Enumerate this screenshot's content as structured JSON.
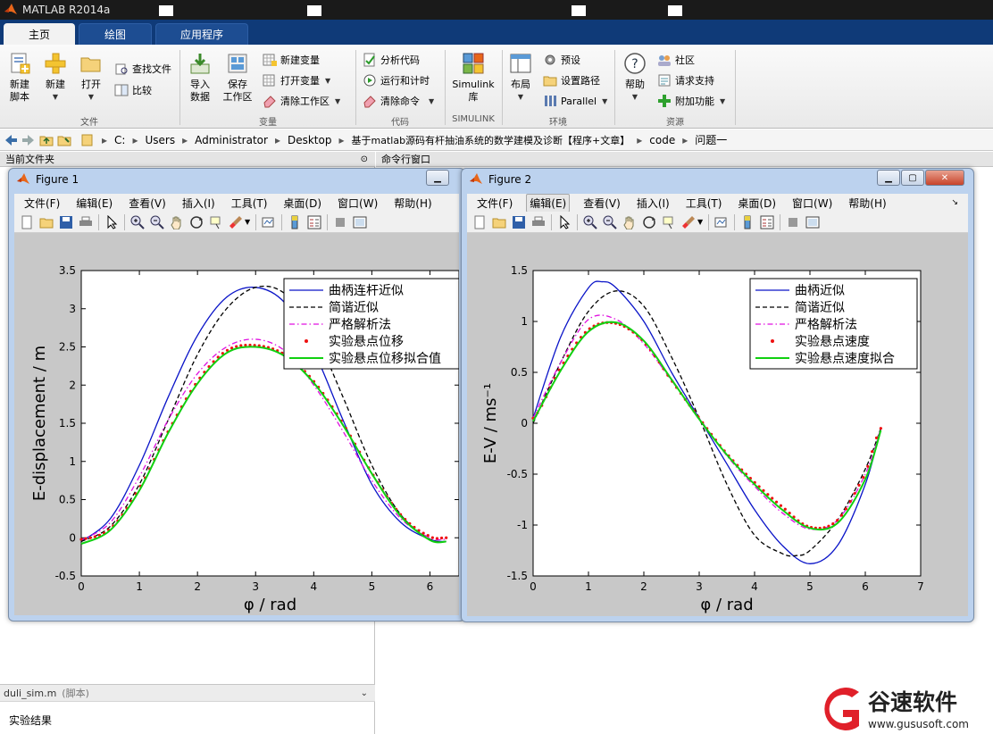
{
  "window": {
    "title": "MATLAB R2014a"
  },
  "tabs": [
    {
      "label": "主页",
      "active": true
    },
    {
      "label": "绘图",
      "active": false
    },
    {
      "label": "应用程序",
      "active": false
    }
  ],
  "ribbon": {
    "file": {
      "new_script": "新建\n脚本",
      "new": "新建",
      "open": "打开",
      "find_files": "查找文件",
      "compare": "比较",
      "group": "文件"
    },
    "variable": {
      "import_data": "导入\n数据",
      "save_workspace": "保存\n工作区",
      "new_variable": "新建变量",
      "open_variable": "打开变量",
      "clear_workspace": "清除工作区",
      "group": "变量"
    },
    "code": {
      "analyze_code": "分析代码",
      "run_and_time": "运行和计时",
      "clear_commands": "清除命令",
      "group": "代码"
    },
    "simulink": {
      "library": "Simulink\n库",
      "group": "SIMULINK"
    },
    "environment": {
      "layout": "布局",
      "preferences": "预设",
      "set_path": "设置路径",
      "parallel": "Parallel",
      "group": "环境"
    },
    "resources": {
      "help": "帮助",
      "community": "社区",
      "request_support": "请求支持",
      "addons": "附加功能",
      "group": "资源"
    }
  },
  "address": {
    "crumbs": [
      "C:",
      "Users",
      "Administrator",
      "Desktop",
      "基于matlab源码有杆抽油系统的数学建模及诊断【程序+文章】",
      "code",
      "问题一"
    ]
  },
  "panels": {
    "current_folder": "当前文件夹",
    "command_window": "命令行窗口",
    "detail_file": "duli_sim.m",
    "detail_type": "(脚本)",
    "detail_text": "实验结果"
  },
  "figure_menu": [
    "文件(F)",
    "编辑(E)",
    "查看(V)",
    "插入(I)",
    "工具(T)",
    "桌面(D)",
    "窗口(W)",
    "帮助(H)"
  ],
  "figure1": {
    "title": "Figure 1"
  },
  "figure2": {
    "title": "Figure 2"
  },
  "watermark": {
    "brand": "谷速软件",
    "url": "www.gususoft.com"
  },
  "colors": {
    "ribbon_tab_bg": "#0f3a78",
    "crank": "#0a14c8",
    "harmonic": "#000000",
    "strict": "#e010e0",
    "measured": "#ee1010",
    "fit": "#10d010"
  },
  "chart_data": [
    {
      "type": "line",
      "title": "",
      "xlabel": "φ / rad",
      "ylabel": "E-displacement / m",
      "xlim": [
        0,
        6.5
      ],
      "ylim": [
        -0.5,
        3.5
      ],
      "xticks": [
        0,
        1,
        2,
        3,
        4,
        5,
        6
      ],
      "yticks": [
        -0.5,
        0,
        0.5,
        1,
        1.5,
        2,
        2.5,
        3,
        3.5
      ],
      "grid": false,
      "legend_position": "top-right",
      "series": [
        {
          "name": "曲柄连杆近似",
          "style": "solid",
          "color": "#0a14c8",
          "x": [
            0,
            0.5,
            1,
            1.5,
            2,
            2.5,
            3,
            3.5,
            4,
            4.5,
            5,
            5.5,
            6,
            6.28
          ],
          "y": [
            -0.05,
            0.25,
            0.95,
            1.85,
            2.65,
            3.15,
            3.28,
            3.08,
            2.45,
            1.55,
            0.7,
            0.2,
            -0.02,
            -0.05
          ]
        },
        {
          "name": "简谐近似",
          "style": "dashed",
          "color": "#000000",
          "x": [
            0,
            0.5,
            1,
            1.5,
            2,
            2.5,
            3,
            3.5,
            4,
            4.5,
            5,
            5.5,
            6,
            6.28
          ],
          "y": [
            -0.05,
            0.15,
            0.7,
            1.55,
            2.4,
            3.0,
            3.28,
            3.2,
            2.7,
            1.85,
            0.95,
            0.3,
            -0.02,
            -0.05
          ]
        },
        {
          "name": "严格解析法",
          "style": "dashdot",
          "color": "#e010e0",
          "x": [
            0,
            0.5,
            1,
            1.5,
            2,
            2.5,
            3,
            3.5,
            4,
            4.5,
            5,
            5.5,
            6,
            6.28
          ],
          "y": [
            -0.03,
            0.2,
            0.8,
            1.55,
            2.15,
            2.5,
            2.6,
            2.45,
            2.0,
            1.4,
            0.75,
            0.25,
            0.0,
            -0.02
          ]
        },
        {
          "name": "实验悬点位移",
          "style": "markers",
          "color": "#ee1010",
          "x": [
            0,
            0.5,
            1,
            1.5,
            2,
            2.5,
            3,
            3.5,
            4,
            4.5,
            5,
            5.5,
            6,
            6.28
          ],
          "y": [
            -0.02,
            0.12,
            0.65,
            1.4,
            2.05,
            2.45,
            2.52,
            2.4,
            2.05,
            1.5,
            0.85,
            0.3,
            0.02,
            0.0
          ]
        },
        {
          "name": "实验悬点位移拟合值",
          "style": "solid",
          "color": "#10d010",
          "x": [
            0,
            0.5,
            1,
            1.5,
            2,
            2.5,
            3,
            3.5,
            4,
            4.5,
            5,
            5.5,
            6,
            6.28
          ],
          "y": [
            -0.08,
            0.1,
            0.62,
            1.38,
            2.02,
            2.42,
            2.5,
            2.38,
            2.03,
            1.48,
            0.84,
            0.28,
            -0.03,
            -0.05
          ]
        }
      ]
    },
    {
      "type": "line",
      "title": "",
      "xlabel": "φ / rad",
      "ylabel": "E-V / ms⁻¹",
      "xlim": [
        0,
        7
      ],
      "ylim": [
        -1.5,
        1.5
      ],
      "xticks": [
        0,
        1,
        2,
        3,
        4,
        5,
        6,
        7
      ],
      "yticks": [
        -1.5,
        -1,
        -0.5,
        0,
        0.5,
        1,
        1.5
      ],
      "grid": false,
      "legend_position": "top-right",
      "series": [
        {
          "name": "曲柄近似",
          "style": "solid",
          "color": "#0a14c8",
          "x": [
            0,
            0.5,
            1,
            1.25,
            1.5,
            2,
            2.5,
            3,
            3.5,
            4,
            4.5,
            5,
            5.5,
            6,
            6.28
          ],
          "y": [
            0.05,
            0.85,
            1.33,
            1.39,
            1.33,
            1.0,
            0.5,
            0.05,
            -0.4,
            -0.85,
            -1.2,
            -1.38,
            -1.2,
            -0.6,
            -0.05
          ]
        },
        {
          "name": "简谐近似",
          "style": "dashed",
          "color": "#000000",
          "x": [
            0,
            0.5,
            1,
            1.5,
            2,
            2.5,
            3,
            3.5,
            4,
            4.5,
            4.75,
            5,
            5.5,
            6,
            6.28
          ],
          "y": [
            0.0,
            0.6,
            1.1,
            1.3,
            1.15,
            0.65,
            0.05,
            -0.6,
            -1.1,
            -1.28,
            -1.3,
            -1.25,
            -0.95,
            -0.45,
            -0.05
          ]
        },
        {
          "name": "严格解析法",
          "style": "dashdot",
          "color": "#e010e0",
          "x": [
            0,
            0.5,
            1,
            1.5,
            2,
            2.5,
            3,
            3.5,
            4,
            4.5,
            5,
            5.5,
            6,
            6.28
          ],
          "y": [
            0.05,
            0.6,
            1.02,
            1.02,
            0.78,
            0.42,
            0.05,
            -0.32,
            -0.62,
            -0.88,
            -1.04,
            -0.95,
            -0.5,
            -0.05
          ]
        },
        {
          "name": "实验悬点速度",
          "style": "markers",
          "color": "#ee1010",
          "x": [
            0,
            0.5,
            1,
            1.5,
            2,
            2.5,
            3,
            3.5,
            4,
            4.5,
            5,
            5.5,
            6,
            6.28
          ],
          "y": [
            0.05,
            0.55,
            0.92,
            0.98,
            0.8,
            0.42,
            0.05,
            -0.3,
            -0.58,
            -0.82,
            -1.02,
            -0.95,
            -0.5,
            -0.05
          ]
        },
        {
          "name": "实验悬点速度拟合",
          "style": "solid",
          "color": "#10d010",
          "x": [
            0,
            0.5,
            1,
            1.5,
            2,
            2.5,
            3,
            3.5,
            4,
            4.5,
            5,
            5.5,
            6,
            6.28
          ],
          "y": [
            0.02,
            0.52,
            0.9,
            0.99,
            0.81,
            0.43,
            0.04,
            -0.31,
            -0.6,
            -0.85,
            -1.03,
            -0.98,
            -0.55,
            -0.07
          ]
        }
      ]
    }
  ]
}
